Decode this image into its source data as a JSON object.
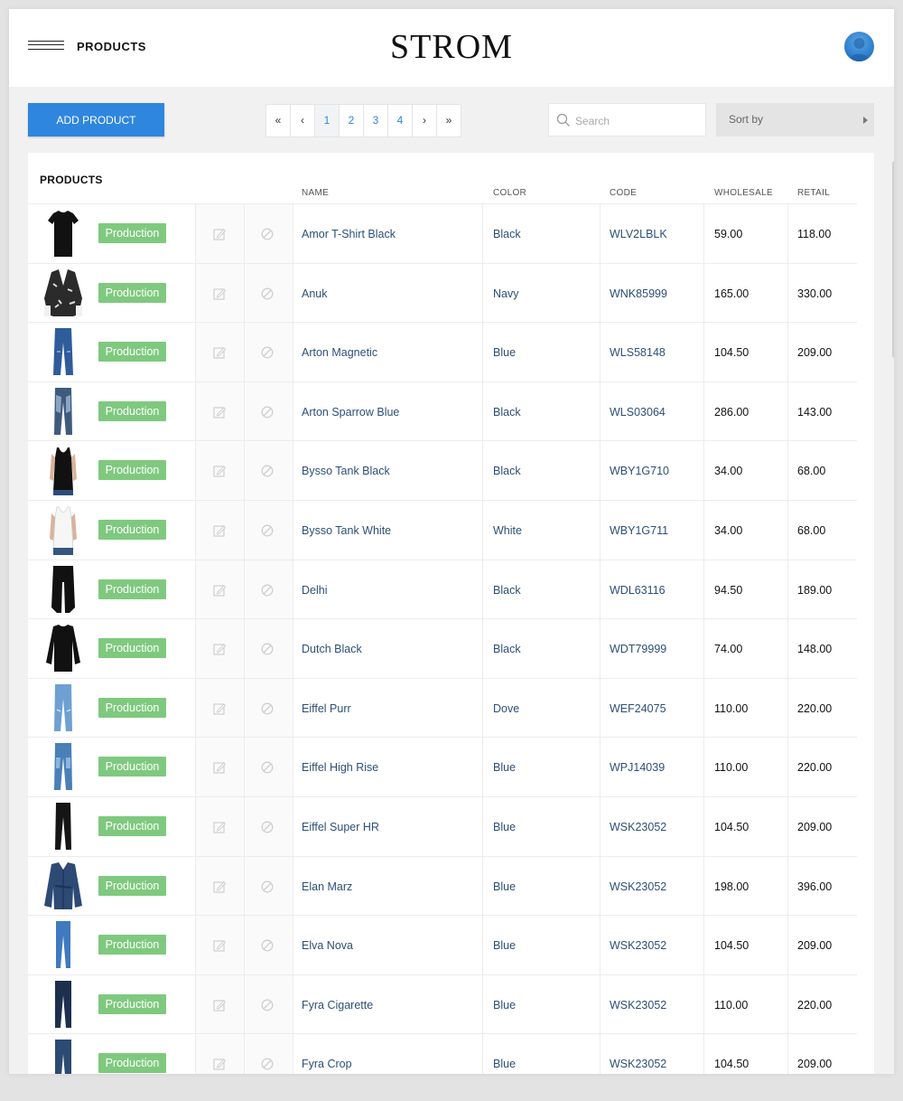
{
  "header": {
    "page_title": "PRODUCTS",
    "logo_text": "STROM"
  },
  "toolbar": {
    "add_product_label": "ADD PRODUCT",
    "pagination": {
      "first": "«",
      "prev": "‹",
      "pages": [
        "1",
        "2",
        "3",
        "4"
      ],
      "current": "1",
      "next": "›",
      "last": "»"
    },
    "search": {
      "placeholder": "Search",
      "value": ""
    },
    "sort": {
      "label": "Sort by"
    }
  },
  "table": {
    "title": "PRODUCTS",
    "columns": {
      "name": "NAME",
      "color": "COLOR",
      "code": "CODE",
      "wholesale": "WHOLESALE",
      "retail": "RETAIL"
    },
    "rows": [
      {
        "status": "Production",
        "name": "Amor T-Shirt Black",
        "color": "Black",
        "code": "WLV2LBLK",
        "wholesale": "59.00",
        "retail": "118.00",
        "garment": "tshirt-black"
      },
      {
        "status": "Production",
        "name": "Anuk",
        "color": "Navy",
        "code": "WNK85999",
        "wholesale": "165.00",
        "retail": "330.00",
        "garment": "printed-top"
      },
      {
        "status": "Production",
        "name": "Arton Magnetic",
        "color": "Blue",
        "code": "WLS58148",
        "wholesale": "104.50",
        "retail": "209.00",
        "garment": "jeans-blue"
      },
      {
        "status": "Production",
        "name": "Arton Sparrow Blue",
        "color": "Black",
        "code": "WLS03064",
        "wholesale": "286.00",
        "retail": "143.00",
        "garment": "jeans-faded"
      },
      {
        "status": "Production",
        "name": "Bysso Tank Black",
        "color": "Black",
        "code": "WBY1G710",
        "wholesale": "34.00",
        "retail": "68.00",
        "garment": "tank-black"
      },
      {
        "status": "Production",
        "name": "Bysso Tank White",
        "color": "White",
        "code": "WBY1G711",
        "wholesale": "34.00",
        "retail": "68.00",
        "garment": "tank-white"
      },
      {
        "status": "Production",
        "name": "Delhi",
        "color": "Black",
        "code": "WDL63116",
        "wholesale": "94.50",
        "retail": "189.00",
        "garment": "pants-black"
      },
      {
        "status": "Production",
        "name": "Dutch Black",
        "color": "Black",
        "code": "WDT79999",
        "wholesale": "74.00",
        "retail": "148.00",
        "garment": "sweater-black"
      },
      {
        "status": "Production",
        "name": "Eiffel Purr",
        "color": "Dove",
        "code": "WEF24075",
        "wholesale": "110.00",
        "retail": "220.00",
        "garment": "jeans-light"
      },
      {
        "status": "Production",
        "name": "Eiffel High Rise",
        "color": "Blue",
        "code": "WPJ14039",
        "wholesale": "110.00",
        "retail": "220.00",
        "garment": "jeans-mid"
      },
      {
        "status": "Production",
        "name": "Eiffel Super HR",
        "color": "Blue",
        "code": "WSK23052",
        "wholesale": "104.50",
        "retail": "209.00",
        "garment": "jeans-black"
      },
      {
        "status": "Production",
        "name": "Elan Marz",
        "color": "Blue",
        "code": "WSK23052",
        "wholesale": "198.00",
        "retail": "396.00",
        "garment": "jacket-denim"
      },
      {
        "status": "Production",
        "name": "Elva Nova",
        "color": "Blue",
        "code": "WSK23052",
        "wholesale": "104.50",
        "retail": "209.00",
        "garment": "jeans-skinny"
      },
      {
        "status": "Production",
        "name": "Fyra Cigarette",
        "color": "Blue",
        "code": "WSK23052",
        "wholesale": "110.00",
        "retail": "220.00",
        "garment": "jeans-dark"
      },
      {
        "status": "Production",
        "name": "Fyra Crop",
        "color": "Blue",
        "code": "WSK23052",
        "wholesale": "104.50",
        "retail": "209.00",
        "garment": "jeans-crop"
      }
    ]
  },
  "colors": {
    "accent": "#2e86de",
    "badge_green": "#7fc97f",
    "link_text": "#2c4f76"
  }
}
